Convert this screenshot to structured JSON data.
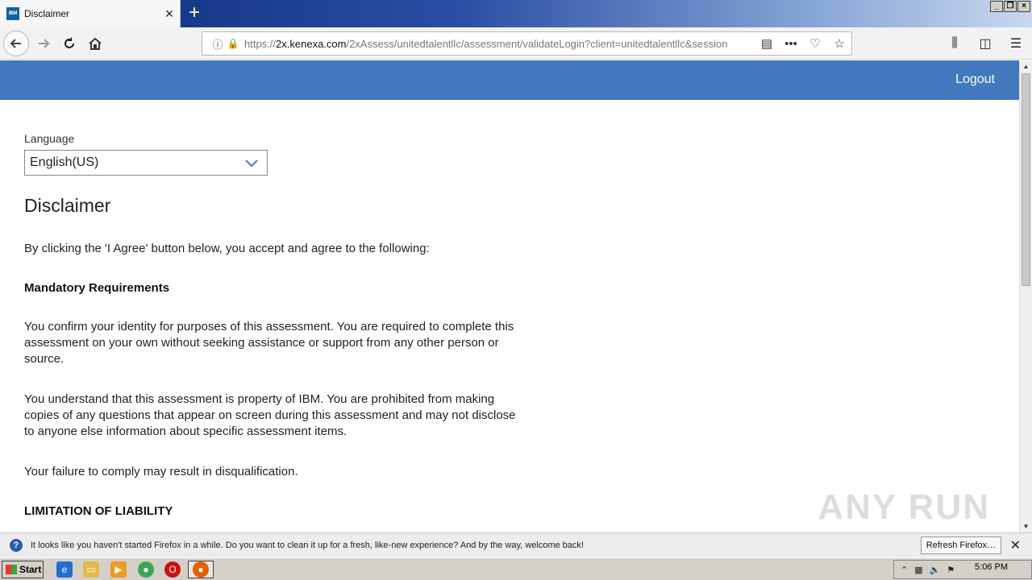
{
  "browser": {
    "tab_title": "Disclaimer",
    "favicon_text": "IBM",
    "url_domain": "2x.kenexa.com",
    "url_prefix": "https://",
    "url_rest": "/2xAssess/unitedtalentllc/assessment/validateLogin?client=unitedtalentllc&session"
  },
  "header": {
    "logout_label": "Logout"
  },
  "language": {
    "label": "Language",
    "selected": "English(US)"
  },
  "disclaimer": {
    "title": "Disclaimer",
    "intro": "By clicking the 'I Agree' button below, you accept and agree to the following:",
    "mandatory_heading": "Mandatory Requirements",
    "para1": "You confirm your identity for purposes of this assessment. You are required to complete this assessment on your own without seeking assistance or support from any other person or source.",
    "para2": "You understand that this assessment is property of IBM. You are prohibited from making copies of any questions that appear on screen during this assessment and may not disclose to anyone else information about specific assessment items.",
    "para3": "Your failure to comply may result in disqualification.",
    "liability_heading": "LIMITATION OF LIABILITY"
  },
  "notification": {
    "text": "It looks like you haven't started Firefox in a while. Do you want to clean it up for a fresh, like-new experience? And by the way, welcome back!",
    "button_label": "Refresh Firefox…"
  },
  "taskbar": {
    "start_label": "Start",
    "clock": "5:06 PM"
  },
  "watermark": "ANY RUN",
  "colors": {
    "header_blue": "#4178be",
    "titlebar_dark": "#0b2a7a"
  }
}
